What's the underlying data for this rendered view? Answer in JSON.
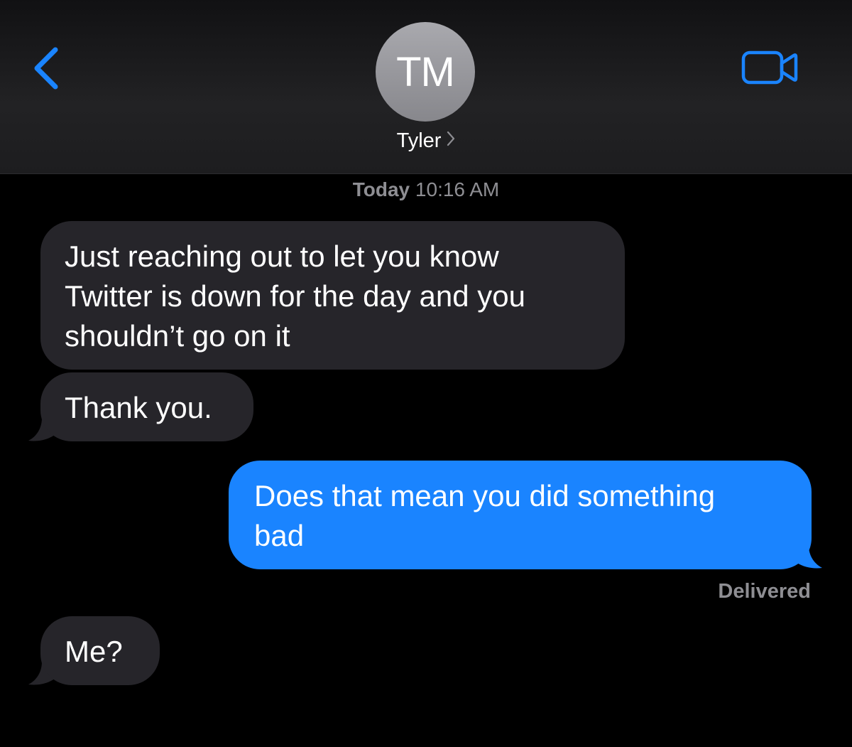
{
  "header": {
    "avatar_initials": "TM",
    "contact_name": "Tyler",
    "back_icon": "chevron-left-icon",
    "video_icon": "video-camera-icon",
    "accent_color": "#1a84ff"
  },
  "timestamp": {
    "day": "Today",
    "time": "10:16 AM"
  },
  "messages": [
    {
      "direction": "incoming",
      "text": "Just reaching out to let you know\nTwitter is down for the day and you\nshouldn’t go on it"
    },
    {
      "direction": "incoming",
      "text": "Thank you."
    },
    {
      "direction": "outgoing",
      "text": "Does that mean you did something\nbad"
    },
    {
      "direction": "incoming",
      "text": "Me?"
    }
  ],
  "status": {
    "delivered_label": "Delivered"
  },
  "colors": {
    "background": "#000000",
    "incoming_bubble": "#26252a",
    "outgoing_bubble": "#1a84ff",
    "secondary_text": "#8e8e93"
  }
}
